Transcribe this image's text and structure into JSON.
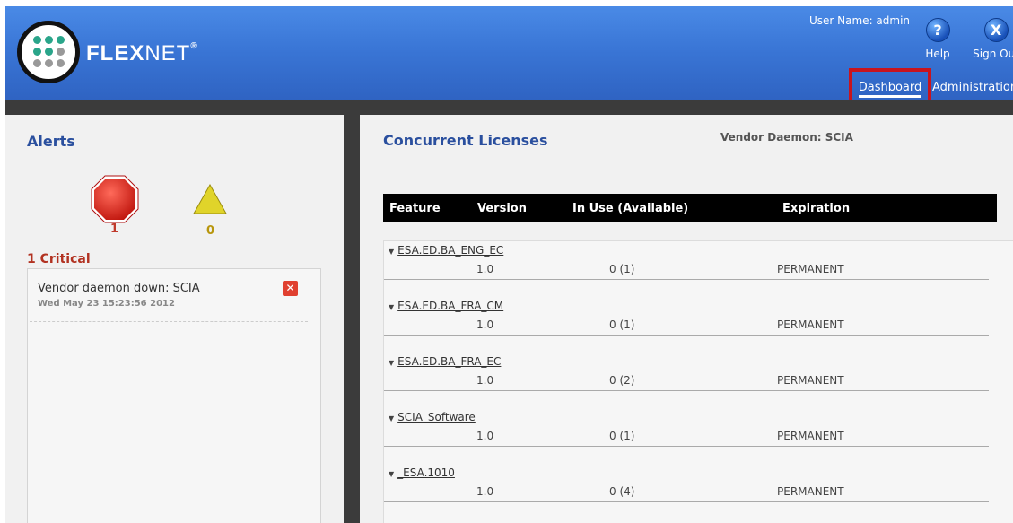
{
  "header": {
    "logo_bold": "FLEX",
    "logo_thin": "NET",
    "logo_mark": "®",
    "user_label": "User Name: admin",
    "help_label": "Help",
    "signout_label": "Sign Out",
    "help_icon": "?",
    "signout_icon": "X",
    "nav": {
      "dashboard": "Dashboard",
      "administration": "Administration"
    }
  },
  "alerts": {
    "title": "Alerts",
    "critical_count": "1",
    "warning_count": "0",
    "critical_heading": "1 Critical",
    "items": [
      {
        "message": "Vendor daemon down: SCIA",
        "time": "Wed May 23 15:23:56 2012",
        "close_icon": "✕"
      }
    ]
  },
  "licenses": {
    "title": "Concurrent Licenses",
    "vendor_daemon": "Vendor Daemon: SCIA",
    "columns": [
      "Feature",
      "Version",
      "In Use (Available)",
      "Expiration"
    ],
    "rows": [
      {
        "feature": "ESA.ED.BA_ENG_EC",
        "version": "1.0",
        "in_use": "0 (1)",
        "expiration": "PERMANENT"
      },
      {
        "feature": "ESA.ED.BA_FRA_CM",
        "version": "1.0",
        "in_use": "0 (1)",
        "expiration": "PERMANENT"
      },
      {
        "feature": "ESA.ED.BA_FRA_EC",
        "version": "1.0",
        "in_use": "0 (2)",
        "expiration": "PERMANENT"
      },
      {
        "feature": "SCIA_Software",
        "version": "1.0",
        "in_use": "0 (1)",
        "expiration": "PERMANENT"
      },
      {
        "feature": "_ESA.1010",
        "version": "1.0",
        "in_use": "0 (4)",
        "expiration": "PERMANENT"
      }
    ]
  },
  "icons": {
    "critical": "octagon-stop-icon",
    "warning": "warning-triangle-icon",
    "expand": "triangle-down-icon"
  },
  "colors": {
    "header_blue": "#3a76d6",
    "title_blue": "#2a4f9e",
    "critical_red": "#c0392b",
    "warning_yellow": "#d8c81e",
    "highlight_red": "#c8141e"
  }
}
